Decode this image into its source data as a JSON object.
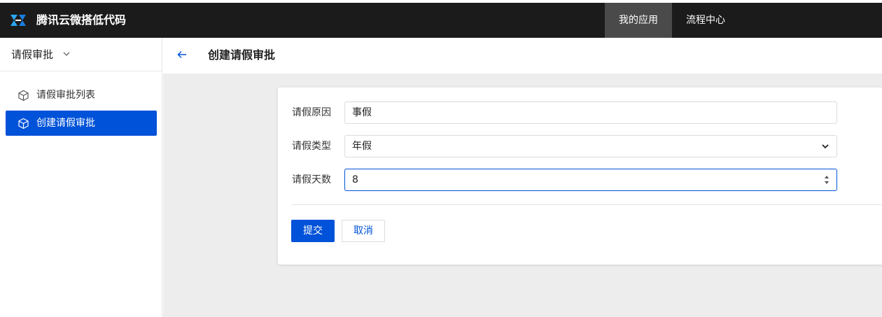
{
  "header": {
    "brand": "腾讯云微搭低代码",
    "nav": [
      {
        "label": "我的应用",
        "active": true
      },
      {
        "label": "流程中心",
        "active": false
      }
    ],
    "colors": {
      "bg": "#1b1b1b",
      "active_bg": "#4a4a4a",
      "logo": "#2aa8f2"
    }
  },
  "sidebar": {
    "title": "请假审批",
    "title_icon": "chevron-down-icon",
    "items": [
      {
        "label": "请假审批列表",
        "icon": "cube-icon",
        "active": false
      },
      {
        "label": "创建请假审批",
        "icon": "cube-icon",
        "active": true
      }
    ],
    "accent": "#0052d9"
  },
  "page": {
    "back_icon": "arrow-left-icon",
    "title": "创建请假审批"
  },
  "form": {
    "fields": [
      {
        "label": "请假原因",
        "type": "text",
        "value": "事假"
      },
      {
        "label": "请假类型",
        "type": "select",
        "value": "年假"
      },
      {
        "label": "请假天数",
        "type": "number",
        "value": "8"
      }
    ],
    "submit_label": "提交",
    "cancel_label": "取消"
  }
}
